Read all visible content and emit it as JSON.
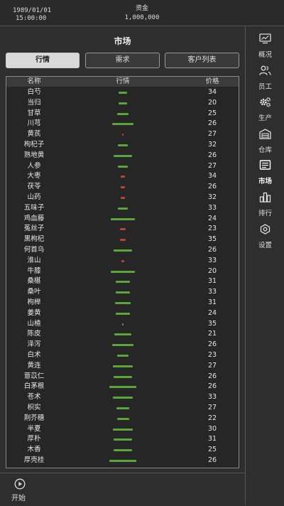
{
  "header": {
    "date": "1989/01/01",
    "time": "15:00:00",
    "fund_label": "资金",
    "fund_value": "1,000,000"
  },
  "main": {
    "title": "市场",
    "tabs": [
      {
        "label": "行情"
      },
      {
        "label": "需求"
      },
      {
        "label": "客户列表"
      }
    ],
    "table": {
      "columns": [
        "名称",
        "行情",
        "价格"
      ],
      "rows": [
        {
          "name": "白芍",
          "trend": 0.35,
          "price": "34"
        },
        {
          "name": "当归",
          "trend": 0.35,
          "price": "20"
        },
        {
          "name": "甘草",
          "trend": 0.45,
          "price": "25"
        },
        {
          "name": "川芎",
          "trend": 0.9,
          "price": "26"
        },
        {
          "name": "黄芪",
          "trend": -0.05,
          "price": "27"
        },
        {
          "name": "枸杞子",
          "trend": 0.4,
          "price": "32"
        },
        {
          "name": "熟地黄",
          "trend": 0.75,
          "price": "26"
        },
        {
          "name": "人参",
          "trend": 0.4,
          "price": "27"
        },
        {
          "name": "大枣",
          "trend": -0.2,
          "price": "34"
        },
        {
          "name": "茯苓",
          "trend": -0.2,
          "price": "26"
        },
        {
          "name": "山药",
          "trend": -0.15,
          "price": "32"
        },
        {
          "name": "五味子",
          "trend": 0.4,
          "price": "33"
        },
        {
          "name": "鸡血藤",
          "trend": 1.0,
          "price": "24"
        },
        {
          "name": "菟丝子",
          "trend": -0.25,
          "price": "23"
        },
        {
          "name": "黑枸杞",
          "trend": -0.25,
          "price": "35"
        },
        {
          "name": "何首乌",
          "trend": 0.75,
          "price": "26"
        },
        {
          "name": "淮山",
          "trend": -0.1,
          "price": "33"
        },
        {
          "name": "牛膝",
          "trend": 1.0,
          "price": "20"
        },
        {
          "name": "桑椹",
          "trend": 0.6,
          "price": "31"
        },
        {
          "name": "桑叶",
          "trend": 0.6,
          "price": "33"
        },
        {
          "name": "枸榉",
          "trend": 0.65,
          "price": "31"
        },
        {
          "name": "姜黄",
          "trend": 0.6,
          "price": "24"
        },
        {
          "name": "山楂",
          "trend": 0.02,
          "price": "35"
        },
        {
          "name": "陈皮",
          "trend": 0.7,
          "price": "21"
        },
        {
          "name": "泽泻",
          "trend": 0.9,
          "price": "26"
        },
        {
          "name": "白术",
          "trend": 0.45,
          "price": "23"
        },
        {
          "name": "黄连",
          "trend": 0.85,
          "price": "27"
        },
        {
          "name": "薏苡仁",
          "trend": 0.75,
          "price": "26"
        },
        {
          "name": "白茅根",
          "trend": 1.1,
          "price": "26"
        },
        {
          "name": "苍术",
          "trend": 0.85,
          "price": "33"
        },
        {
          "name": "枳实",
          "trend": 0.55,
          "price": "27"
        },
        {
          "name": "荆芥穗",
          "trend": 0.5,
          "price": "22"
        },
        {
          "name": "半夏",
          "trend": 0.85,
          "price": "30"
        },
        {
          "name": "厚朴",
          "trend": 0.75,
          "price": "31"
        },
        {
          "name": "木香",
          "trend": 0.75,
          "price": "25"
        },
        {
          "name": "厚壳桂",
          "trend": 1.1,
          "price": "26"
        }
      ]
    }
  },
  "sidebar": {
    "items": [
      {
        "label": "概况",
        "icon": "monitor-chart-icon"
      },
      {
        "label": "员工",
        "icon": "people-icon"
      },
      {
        "label": "生产",
        "icon": "gears-icon"
      },
      {
        "label": "仓库",
        "icon": "warehouse-icon"
      },
      {
        "label": "市场",
        "icon": "market-board-icon"
      },
      {
        "label": "排行",
        "icon": "ranking-bars-icon"
      },
      {
        "label": "设置",
        "icon": "settings-icon"
      }
    ],
    "active": "市场"
  },
  "footer": {
    "start_label": "开始",
    "icon": "play-icon"
  },
  "colors": {
    "up": "#5aa63a",
    "down": "#b8443b",
    "background": "#2e2e2e"
  }
}
